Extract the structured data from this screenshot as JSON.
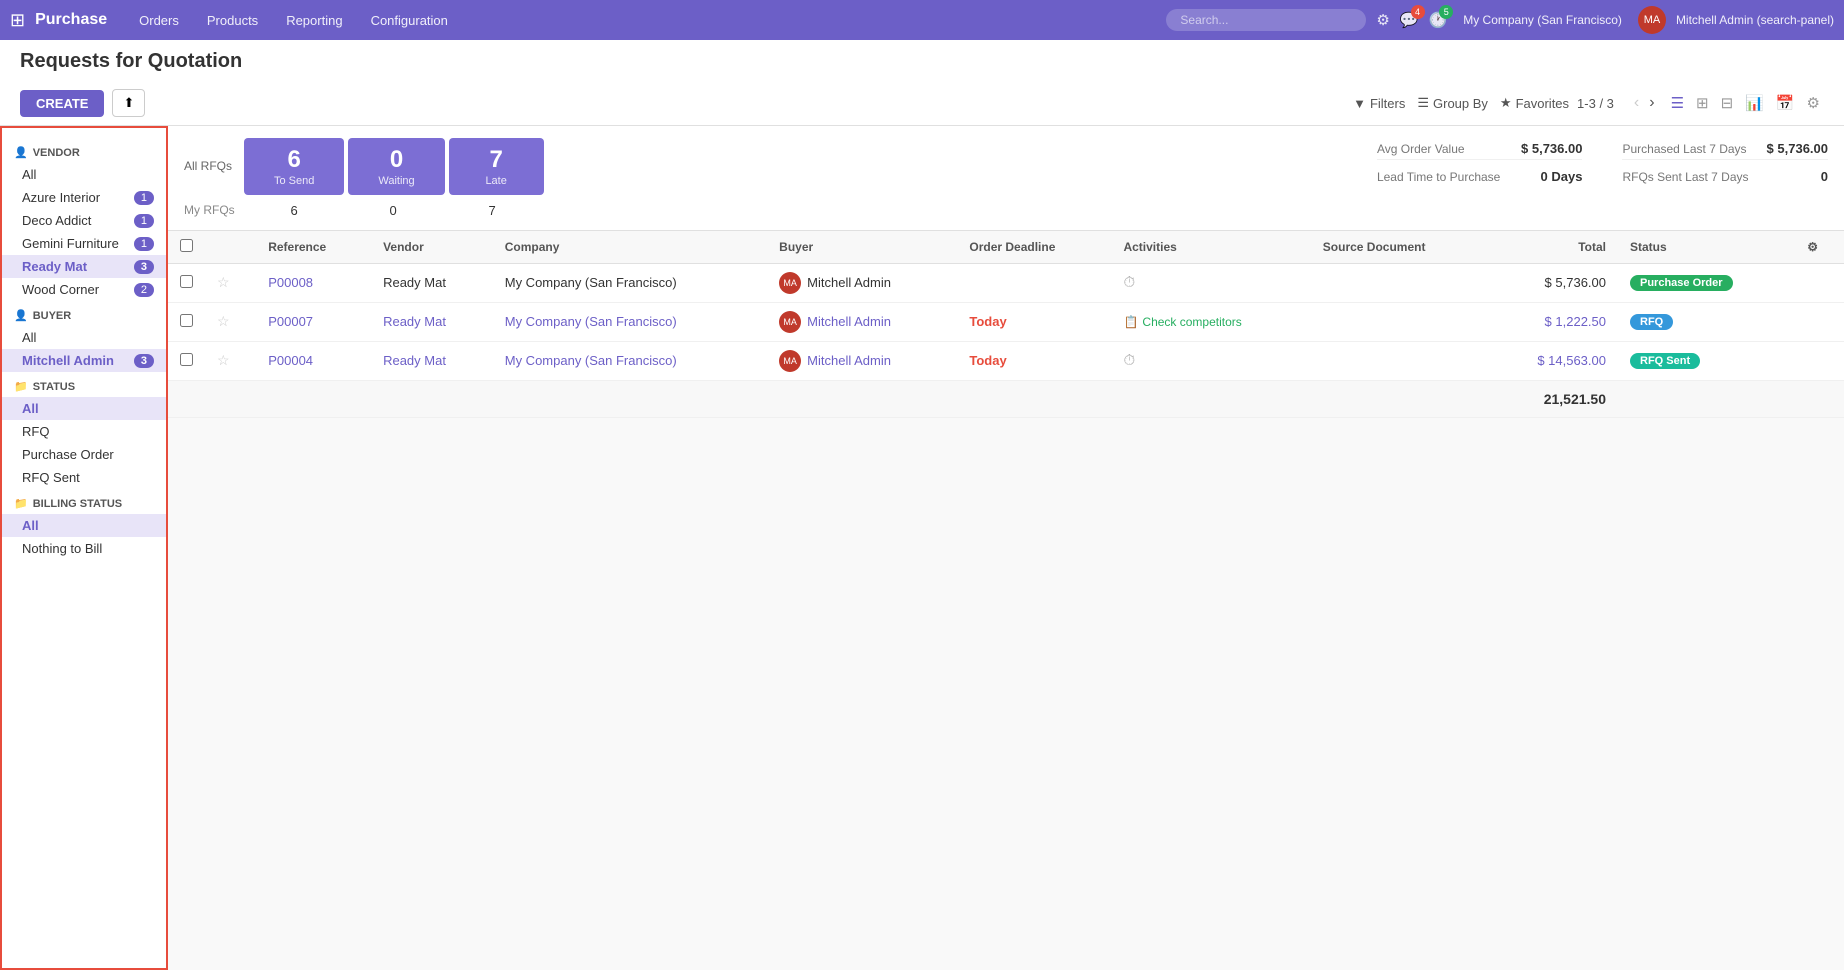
{
  "app": {
    "name": "Purchase",
    "nav_items": [
      "Orders",
      "Products",
      "Reporting",
      "Configuration"
    ],
    "search_placeholder": "Search...",
    "icons": {
      "settings": "⚙",
      "chat": "💬",
      "clock": "🕐",
      "search": "🔍"
    },
    "chat_badge": "4",
    "clock_badge": "5",
    "company": "My Company (San Francisco)",
    "user_name": "Mitchell Admin (search-panel)",
    "user_initials": "MA"
  },
  "page": {
    "title": "Requests for Quotation",
    "breadcrumb": "# Purchase"
  },
  "toolbar": {
    "create_label": "CREATE",
    "upload_icon": "⬆",
    "filters_label": "Filters",
    "groupby_label": "Group By",
    "favorites_label": "Favorites",
    "pagination": "1-3 / 3",
    "views": [
      "list",
      "kanban",
      "pivot",
      "chart",
      "calendar",
      "settings"
    ]
  },
  "stats": {
    "all_rfqs_label": "All RFQs",
    "to_send_count": "6",
    "to_send_label": "To Send",
    "waiting_count": "0",
    "waiting_label": "Waiting",
    "late_count": "7",
    "late_label": "Late",
    "my_rfqs_label": "My RFQs",
    "my_to_send": "6",
    "my_waiting": "0",
    "my_late": "7",
    "avg_order_label": "Avg Order Value",
    "avg_order_value": "$ 5,736.00",
    "purchased_last7_label": "Purchased Last 7 Days",
    "purchased_last7_value": "$ 5,736.00",
    "lead_time_label": "Lead Time to Purchase",
    "lead_time_value": "0 Days",
    "rfq_sent_label": "RFQs Sent Last 7 Days",
    "rfq_sent_value": "0"
  },
  "sidebar": {
    "vendor_label": "VENDOR",
    "vendor_items": [
      {
        "name": "All",
        "count": null,
        "active": false
      },
      {
        "name": "Azure Interior",
        "count": "1",
        "active": false
      },
      {
        "name": "Deco Addict",
        "count": "1",
        "active": false
      },
      {
        "name": "Gemini Furniture",
        "count": "1",
        "active": false
      },
      {
        "name": "Ready Mat",
        "count": "3",
        "active": true
      },
      {
        "name": "Wood Corner",
        "count": "2",
        "active": false
      }
    ],
    "buyer_label": "BUYER",
    "buyer_items": [
      {
        "name": "All",
        "count": null,
        "active": false
      },
      {
        "name": "Mitchell Admin",
        "count": "3",
        "active": true
      }
    ],
    "status_label": "STATUS",
    "status_items": [
      {
        "name": "All",
        "count": null,
        "active": true
      },
      {
        "name": "RFQ",
        "count": null,
        "active": false
      },
      {
        "name": "Purchase Order",
        "count": null,
        "active": false
      },
      {
        "name": "RFQ Sent",
        "count": null,
        "active": false
      }
    ],
    "billing_label": "BILLING STATUS",
    "billing_items": [
      {
        "name": "All",
        "count": null,
        "active": true
      },
      {
        "name": "Nothing to Bill",
        "count": null,
        "active": false
      }
    ]
  },
  "table": {
    "columns": [
      "",
      "",
      "Reference",
      "Vendor",
      "Company",
      "Buyer",
      "Order Deadline",
      "Activities",
      "Source Document",
      "Total",
      "Status",
      ""
    ],
    "rows": [
      {
        "ref": "P00008",
        "vendor": "Ready Mat",
        "vendor_link": false,
        "company": "My Company (San Francisco)",
        "company_link": false,
        "buyer": "Mitchell Admin",
        "deadline": "",
        "activity": "⏱",
        "source": "",
        "total": "$ 5,736.00",
        "status": "Purchase Order",
        "status_class": "badge-purchase"
      },
      {
        "ref": "P00007",
        "vendor": "Ready Mat",
        "vendor_link": true,
        "company": "My Company (San Francisco)",
        "company_link": true,
        "buyer": "Mitchell Admin",
        "deadline": "Today",
        "activity": "check",
        "activity_text": "Check competitors",
        "source": "",
        "total": "$ 1,222.50",
        "status": "RFQ",
        "status_class": "badge-rfq"
      },
      {
        "ref": "P00004",
        "vendor": "Ready Mat",
        "vendor_link": true,
        "company": "My Company (San Francisco)",
        "company_link": true,
        "buyer": "Mitchell Admin",
        "deadline": "Today",
        "activity": "⏱",
        "source": "",
        "total": "$ 14,563.00",
        "status": "RFQ Sent",
        "status_class": "badge-rfqsent"
      }
    ],
    "total_label": "21,521.50"
  }
}
